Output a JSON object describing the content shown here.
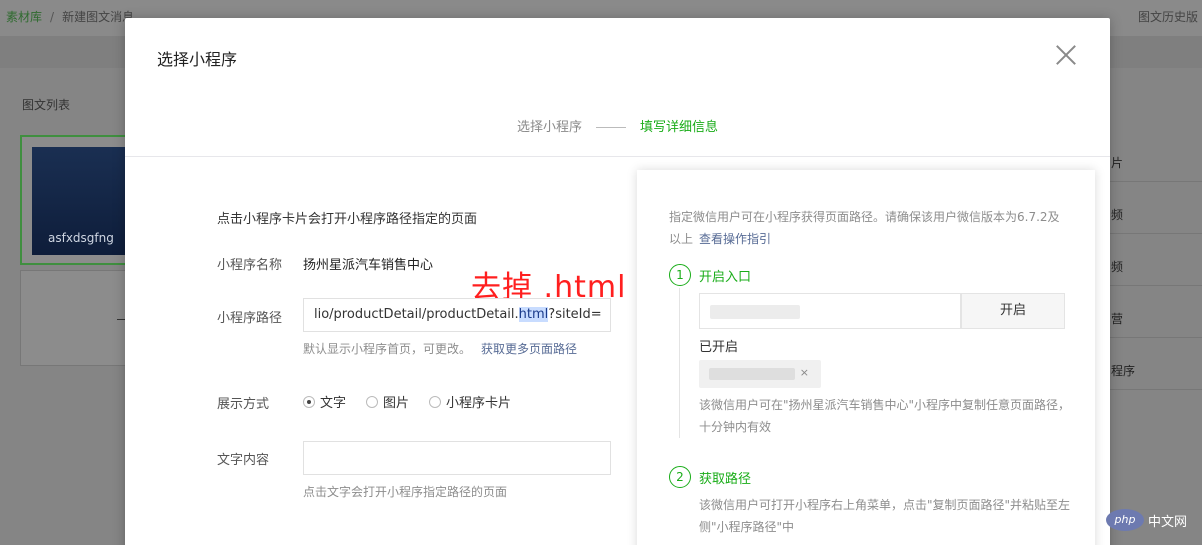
{
  "background": {
    "breadcrumb": [
      "素材库",
      "新建图文消息"
    ],
    "history_link": "图文历史版",
    "list_title": "图文列表",
    "card_text": "asfxdsgfng",
    "right_items": [
      "片",
      "频",
      "频",
      "营",
      "程序"
    ]
  },
  "modal": {
    "title": "选择小程序",
    "steps": [
      "选择小程序",
      "填写详细信息"
    ],
    "description": "点击小程序卡片会打开小程序路径指定的页面",
    "name_label": "小程序名称",
    "name_value": "扬州星派汽车销售中心",
    "annotation": "去掉 .html",
    "path_label": "小程序路径",
    "path_prefix": "lio/productDetail/productDetail.",
    "path_highlight": "html",
    "path_suffix": "?siteId=",
    "path_hint": "默认显示小程序首页，可更改。",
    "path_hint_link": "获取更多页面路径",
    "display_label": "展示方式",
    "display_options": [
      "文字",
      "图片",
      "小程序卡片"
    ],
    "display_selected": "文字",
    "text_label": "文字内容",
    "text_value": "",
    "text_hint": "点击文字会打开小程序指定路径的页面"
  },
  "panel": {
    "intro": "指定微信用户可在小程序获得页面路径。请确保该用户微信版本为6.7.2及以上",
    "intro_link": "查看操作指引",
    "step1": {
      "num": "1",
      "title": "开启入口"
    },
    "open_button": "开启",
    "opened_label": "已开启",
    "opened_close": "×",
    "step1_note": "该微信用户可在\"扬州星派汽车销售中心\"小程序中复制任意页面路径，十分钟内有效",
    "step2": {
      "num": "2",
      "title": "获取路径"
    },
    "step2_note": "该微信用户可打开小程序右上角菜单，点击\"复制页面路径\"并粘贴至左侧\"小程序路径\"中"
  },
  "watermark": {
    "logo": "php",
    "text": "中文网"
  },
  "colors": {
    "accent": "#1aad19",
    "link": "#576b95",
    "annotation": "#ff1f1f"
  }
}
